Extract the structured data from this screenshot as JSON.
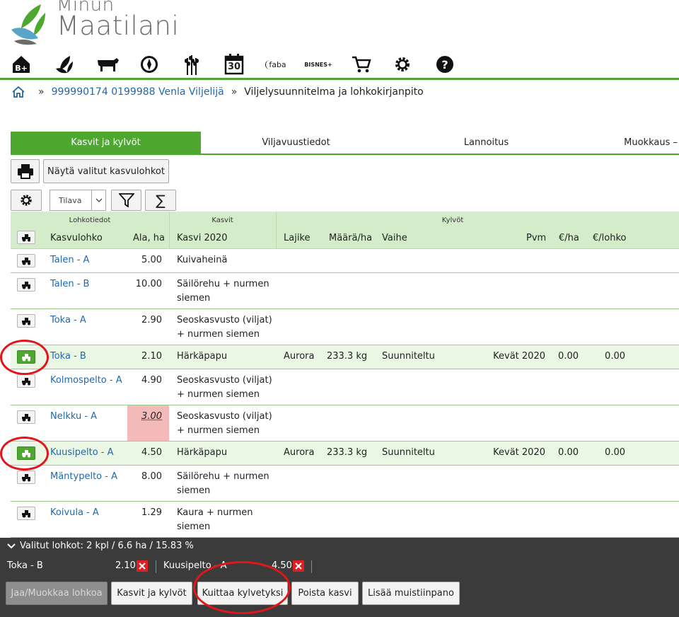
{
  "brand": {
    "line1": "Minun",
    "line2": "Maatilani"
  },
  "nav_icons": [
    "b-plus-icon",
    "leaves-icon",
    "cow-icon",
    "compass-icon",
    "wheat-icon",
    "calendar-icon",
    "faba-logo-icon",
    "bisnes-logo-icon",
    "cart-icon",
    "gear-icon",
    "help-icon"
  ],
  "nav_text": {
    "calendar_day": "30",
    "faba": "faba",
    "bisnes": "BISNES+"
  },
  "breadcrumb": {
    "sep": "»",
    "farm": "999990174 0199988 Venla Viljelijä",
    "current": "Viljelysuunnitelma ja lohkokirjanpito"
  },
  "tabs": [
    "Kasvit ja kylvöt",
    "Viljavuustiedot",
    "Lannoitus",
    "Muokkaus –"
  ],
  "toolbar": {
    "show_selected": "Näytä valitut kasvulohkot",
    "view_select": "Tilava",
    "sum_symbol": "∑"
  },
  "table": {
    "groups": {
      "lohko": "Lohkotiedot",
      "kasvit": "Kasvit",
      "kylvot": "Kylvöt"
    },
    "columns": {
      "kasvulohko": "Kasvulohko",
      "ala": "Ala, ha",
      "kasvi": "Kasvi 2020",
      "lajike": "Lajike",
      "maara": "Määrä/ha",
      "vaihe": "Vaihe",
      "pvm": "Pvm",
      "eur_ha": "€/ha",
      "eur_lohko": "€/lohko"
    },
    "rows": [
      {
        "name": "Talen - A",
        "ala": "5.00",
        "kasvi1": "Kuivaheinä",
        "kasvi2": "",
        "selected": false
      },
      {
        "name": "Talen - B",
        "ala": "10.00",
        "kasvi1": "Säilörehu + nurmen",
        "kasvi2": "siemen",
        "selected": false
      },
      {
        "name": "Toka - A",
        "ala": "2.90",
        "kasvi1": "Seoskasvusto (viljat)",
        "kasvi2": "+ nurmen siemen",
        "selected": false
      },
      {
        "name": "Toka - B",
        "ala": "2.10",
        "kasvi1": "Härkäpapu",
        "kasvi2": "",
        "selected": true,
        "lajike": "Aurora",
        "maara": "233.3 kg",
        "vaihe": "Suunniteltu",
        "pvm": "Kevät 2020",
        "eur_ha": "0.00",
        "eur_lohko": "0.00"
      },
      {
        "name": "Kolmospelto - A",
        "ala": "4.90",
        "kasvi1": "Seoskasvusto (viljat)",
        "kasvi2": "+ nurmen siemen",
        "selected": false
      },
      {
        "name": "Nelkku - A",
        "ala": "3.00",
        "kasvi1": "Seoskasvusto (viljat)",
        "kasvi2": "+ nurmen siemen",
        "selected": false,
        "warning": true
      },
      {
        "name": "Kuusipelto - A",
        "ala": "4.50",
        "kasvi1": "Härkäpapu",
        "kasvi2": "",
        "selected": true,
        "lajike": "Aurora",
        "maara": "233.3 kg",
        "vaihe": "Suunniteltu",
        "pvm": "Kevät 2020",
        "eur_ha": "0.00",
        "eur_lohko": "0.00"
      },
      {
        "name": "Mäntypelto - A",
        "ala": "8.00",
        "kasvi1": "Säilörehu + nurmen",
        "kasvi2": "siemen",
        "selected": false
      },
      {
        "name": "Koivula - A",
        "ala": "1.29",
        "kasvi1": "Kaura + nurmen",
        "kasvi2": "siemen",
        "selected": false
      }
    ]
  },
  "selection_bar": {
    "summary": "Valitut lohkot: 2 kpl / 6.6 ha / 15.83 %",
    "chips": [
      {
        "name": "Toka - B",
        "ala": "2.10"
      },
      {
        "name": "Kuusipelto - A",
        "ala": "4.50"
      }
    ],
    "buttons": [
      "Jaa/Muokkaa lohkoa",
      "Kasvit ja kylvöt",
      "Kuittaa kylvetyksi",
      "Poista kasvi",
      "Lisää muistiinpano"
    ]
  },
  "colors": {
    "accent": "#4ea72e",
    "link": "#2468a8",
    "selected_row": "#eaf7e4",
    "warning": "#f4b9b9",
    "annotation": "#e0161b",
    "bar": "#3b3b3b"
  }
}
